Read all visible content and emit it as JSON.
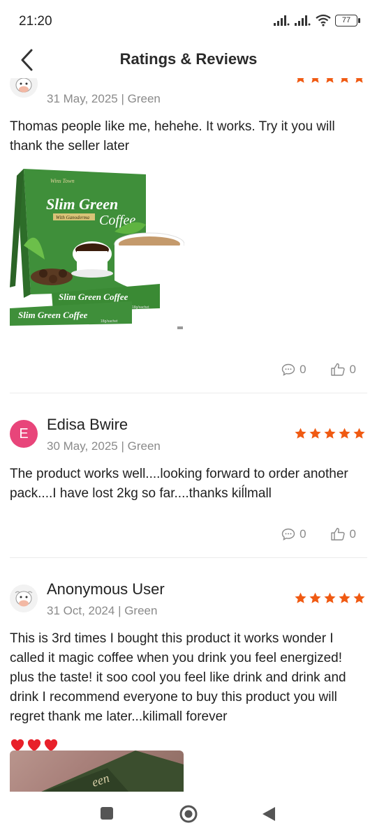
{
  "status_bar": {
    "time": "21:20",
    "battery": "77"
  },
  "header": {
    "title": "Ratings & Reviews"
  },
  "reviews": [
    {
      "name": "",
      "meta": "31 May, 2025 | Green",
      "text": "Thomas people like me, hehehe. It works. Try it you will thank the seller later",
      "rating": 5,
      "comments": "0",
      "likes": "0",
      "image_text": {
        "brand": "Wins Town",
        "title1": "Slim Green",
        "subtitle": "With Ganoderma",
        "title2": "Coffee",
        "sachet1": "Slim Green Coffee",
        "sachet1_small": "18g/sachet",
        "sachet2": "Slim Green Coffee",
        "sachet2_small": "18g/sachet"
      }
    },
    {
      "name": "Edisa Bwire",
      "avatar_letter": "E",
      "meta": "30 May, 2025 | Green",
      "text": "The product works well....looking forward to order another pack....I have lost 2kg so far....thanks kiĺlmall",
      "rating": 5,
      "comments": "0",
      "likes": "0"
    },
    {
      "name": "Anonymous User",
      "meta": "31 Oct, 2024 | Green",
      "text": "This is 3rd times I bought this product it works wonder I called it magic coffee when you drink you feel energized! plus the taste! it soo cool you feel like drink and drink and drink I recommend everyone to buy this product you will regret thank me later...kilimall forever",
      "rating": 5,
      "photo_text": "een"
    }
  ],
  "colors": {
    "star": "#f05a12",
    "avatar_e": "#e8457a",
    "heart": "#e8202a",
    "box_green": "#3f8f3a"
  },
  "icons": [
    "back-icon",
    "signal-icon",
    "wifi-icon",
    "battery-icon",
    "comment-icon",
    "thumbs-up-icon",
    "star-icon",
    "heart-icon",
    "square-nav-icon",
    "home-nav-icon",
    "back-nav-icon"
  ]
}
